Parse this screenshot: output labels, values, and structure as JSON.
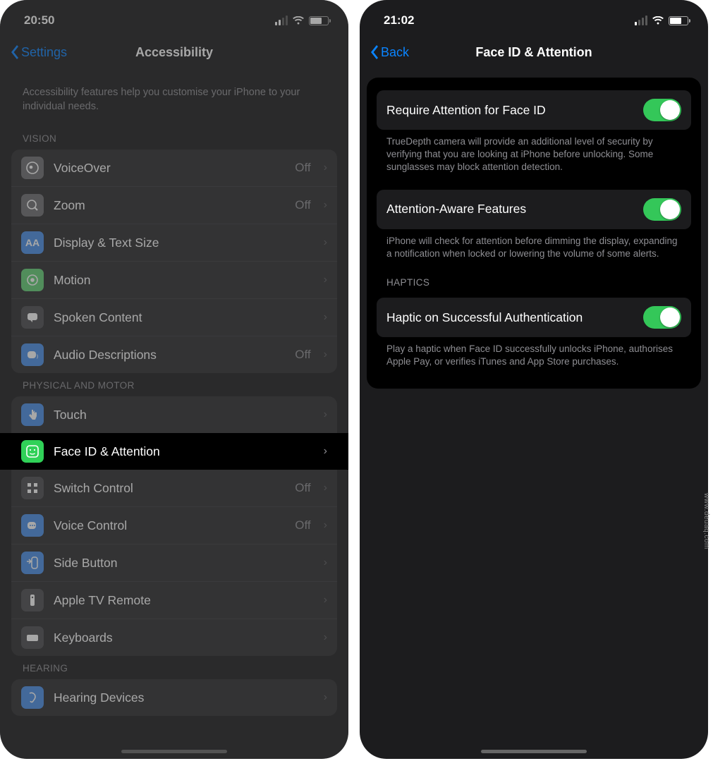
{
  "left": {
    "time": "20:50",
    "back_label": "Settings",
    "title": "Accessibility",
    "intro": "Accessibility features help you customise your iPhone to your individual needs.",
    "sections": {
      "vision": {
        "header": "VISION",
        "items": [
          {
            "label": "VoiceOver",
            "status": "Off"
          },
          {
            "label": "Zoom",
            "status": "Off"
          },
          {
            "label": "Display & Text Size",
            "status": ""
          },
          {
            "label": "Motion",
            "status": ""
          },
          {
            "label": "Spoken Content",
            "status": ""
          },
          {
            "label": "Audio Descriptions",
            "status": "Off"
          }
        ]
      },
      "physical": {
        "header": "PHYSICAL AND MOTOR",
        "items": [
          {
            "label": "Touch",
            "status": ""
          },
          {
            "label": "Face ID & Attention",
            "status": ""
          },
          {
            "label": "Switch Control",
            "status": "Off"
          },
          {
            "label": "Voice Control",
            "status": "Off"
          },
          {
            "label": "Side Button",
            "status": ""
          },
          {
            "label": "Apple TV Remote",
            "status": ""
          },
          {
            "label": "Keyboards",
            "status": ""
          }
        ]
      },
      "hearing": {
        "header": "HEARING",
        "items": [
          {
            "label": "Hearing Devices",
            "status": ""
          }
        ]
      }
    }
  },
  "right": {
    "time": "21:02",
    "back_label": "Back",
    "title": "Face ID & Attention",
    "rows": {
      "require": {
        "label": "Require Attention for Face ID",
        "desc": "TrueDepth camera will provide an additional level of security by verifying that you are looking at iPhone before unlocking. Some sunglasses may block attention detection."
      },
      "aware": {
        "label": "Attention-Aware Features",
        "desc": "iPhone will check for attention before dimming the display, expanding a notification when locked or lowering the volume of some alerts."
      },
      "haptics_header": "HAPTICS",
      "haptic": {
        "label": "Haptic on Successful Authentication",
        "desc": "Play a haptic when Face ID successfully unlocks iPhone, authorises Apple Pay, or verifies iTunes and App Store purchases."
      }
    }
  },
  "watermark": "www.deuaq.com"
}
